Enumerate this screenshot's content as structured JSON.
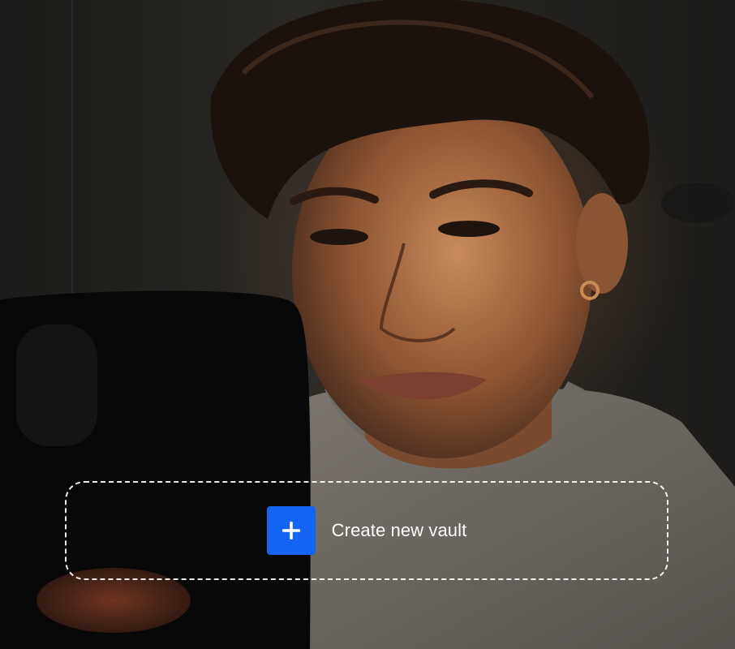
{
  "hero": {
    "image_description_icon": "portrait-photo",
    "accent_color": "#1565f5"
  },
  "vault_action": {
    "label": "Create new vault",
    "icon": "plus-icon"
  }
}
